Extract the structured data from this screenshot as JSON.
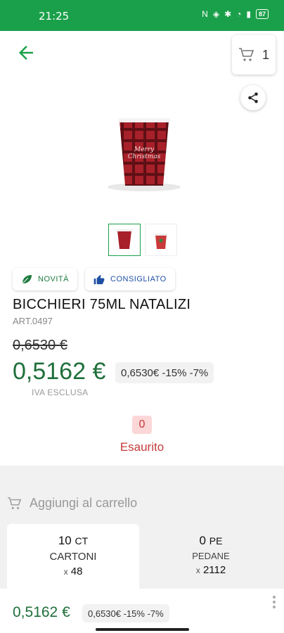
{
  "status": {
    "time": "21:25",
    "battery": "87"
  },
  "header": {
    "cart_count": "1"
  },
  "product": {
    "badges": [
      {
        "label": "NOVITÀ",
        "color": "#1c7a3e"
      },
      {
        "label": "CONSIGLIATO",
        "color": "#1f4fa3"
      }
    ],
    "title": "BICCHIERI 75ML NATALIZI",
    "code": "ART.0497",
    "old_price": "0,6530 €",
    "price": "0,5162 €",
    "discount": "0,6530€ -15% -7%",
    "tax_note": "IVA ESCLUSA",
    "stock_qty": "0",
    "stock_status": "Esaurito",
    "thumbnails_count": 2
  },
  "cart": {
    "add_label": "Aggiungi al carrello",
    "units": [
      {
        "qty": "10",
        "unit": "CT",
        "name": "CARTONI",
        "multiplier": "48",
        "selected": true
      },
      {
        "qty": "0",
        "unit": "PE",
        "name": "PEDANE",
        "multiplier": "2112",
        "selected": false
      }
    ]
  },
  "footer": {
    "price": "0,5162 €",
    "discount": "0,6530€ -15% -7%"
  },
  "colors": {
    "brand_green": "#1aa04a",
    "price_green": "#1f6f3a",
    "out_of_stock_red": "#c63a3a"
  },
  "icons": [
    "arrow-back-icon",
    "cart-icon",
    "share-icon",
    "leaf-icon",
    "thumbs-up-icon",
    "cart-add-icon",
    "more-vert-icon"
  ]
}
